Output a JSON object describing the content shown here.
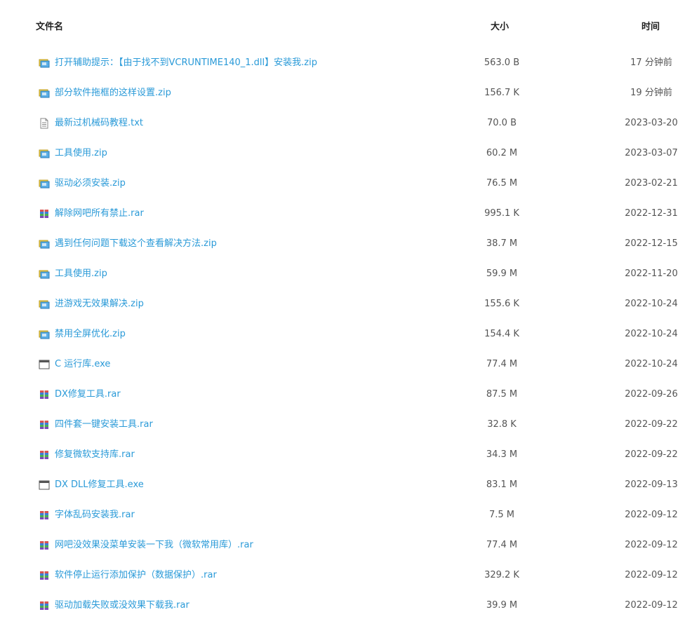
{
  "header": {
    "name_label": "文件名",
    "size_label": "大小",
    "time_label": "时间"
  },
  "colors": {
    "link": "#2a9ad8",
    "text": "#555555",
    "header": "#222222"
  },
  "files": [
    {
      "name": "打开辅助提示：【由于找不到VCRUNTIME140_1.dll】安装我.zip",
      "size": "563.0 B",
      "time": "17 分钟前",
      "icon": "zip-icon"
    },
    {
      "name": "部分软件拖框的这样设置.zip",
      "size": "156.7 K",
      "time": "19 分钟前",
      "icon": "zip-icon"
    },
    {
      "name": "最新过机械码教程.txt",
      "size": "70.0 B",
      "time": "2023-03-20",
      "icon": "txt-icon"
    },
    {
      "name": "工具使用.zip",
      "size": "60.2 M",
      "time": "2023-03-07",
      "icon": "zip-icon"
    },
    {
      "name": "驱动必须安装.zip",
      "size": "76.5 M",
      "time": "2023-02-21",
      "icon": "zip-icon"
    },
    {
      "name": "解除网吧所有禁止.rar",
      "size": "995.1 K",
      "time": "2022-12-31",
      "icon": "rar-icon"
    },
    {
      "name": "遇到任何问题下载这个查看解决方法.zip",
      "size": "38.7 M",
      "time": "2022-12-15",
      "icon": "zip-icon"
    },
    {
      "name": "工具使用.zip",
      "size": "59.9 M",
      "time": "2022-11-20",
      "icon": "zip-icon"
    },
    {
      "name": "进游戏无效果解决.zip",
      "size": "155.6 K",
      "time": "2022-10-24",
      "icon": "zip-icon"
    },
    {
      "name": "禁用全屏优化.zip",
      "size": "154.4 K",
      "time": "2022-10-24",
      "icon": "zip-icon"
    },
    {
      "name": "C 运行库.exe",
      "size": "77.4 M",
      "time": "2022-10-24",
      "icon": "exe-icon"
    },
    {
      "name": "DX修复工具.rar",
      "size": "87.5 M",
      "time": "2022-09-26",
      "icon": "rar-icon"
    },
    {
      "name": "四件套一键安装工具.rar",
      "size": "32.8 K",
      "time": "2022-09-22",
      "icon": "rar-icon"
    },
    {
      "name": "修复微软支持库.rar",
      "size": "34.3 M",
      "time": "2022-09-22",
      "icon": "rar-icon"
    },
    {
      "name": "DX DLL修复工具.exe",
      "size": "83.1 M",
      "time": "2022-09-13",
      "icon": "exe-icon"
    },
    {
      "name": "字体乱码安装我.rar",
      "size": "7.5 M",
      "time": "2022-09-12",
      "icon": "rar-icon"
    },
    {
      "name": "网吧没效果没菜单安装一下我（微软常用库）.rar",
      "size": "77.4 M",
      "time": "2022-09-12",
      "icon": "rar-icon"
    },
    {
      "name": "软件停止运行添加保护（数据保护）.rar",
      "size": "329.2 K",
      "time": "2022-09-12",
      "icon": "rar-icon"
    },
    {
      "name": "驱动加载失败或没效果下载我.rar",
      "size": "39.9 M",
      "time": "2022-09-12",
      "icon": "rar-icon"
    }
  ]
}
